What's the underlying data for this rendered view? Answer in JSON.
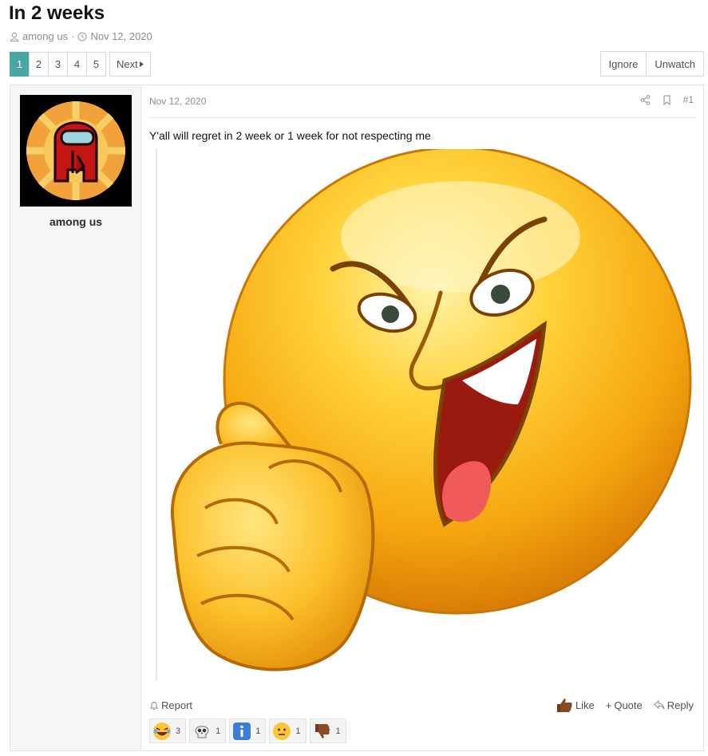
{
  "thread": {
    "title": "In 2 weeks",
    "author": "among us",
    "separator": "·",
    "date": "Nov 12, 2020"
  },
  "pagination": {
    "pages": [
      "1",
      "2",
      "3",
      "4",
      "5"
    ],
    "active_page": "1",
    "next_label": "Next"
  },
  "thread_actions": {
    "ignore_label": "Ignore",
    "unwatch_label": "Unwatch"
  },
  "post": {
    "username": "among us",
    "date": "Nov 12, 2020",
    "number": "#1",
    "text": "Y'all will regret in 2 week or 1 week for not respecting me",
    "report_label": "Report",
    "like_label": "Like",
    "quote_label": "Quote",
    "reply_label": "Reply",
    "reactions": [
      {
        "icon": "laugh-emoji-icon",
        "count": "3"
      },
      {
        "icon": "skull-emoji-icon",
        "count": "1"
      },
      {
        "icon": "info-emoji-icon",
        "count": "1"
      },
      {
        "icon": "neutral-face-emoji-icon",
        "count": "1"
      },
      {
        "icon": "thumbs-down-emoji-icon",
        "count": "1"
      }
    ]
  },
  "colors": {
    "accent": "#47a7a4",
    "muted_text": "#8c8c8c"
  }
}
